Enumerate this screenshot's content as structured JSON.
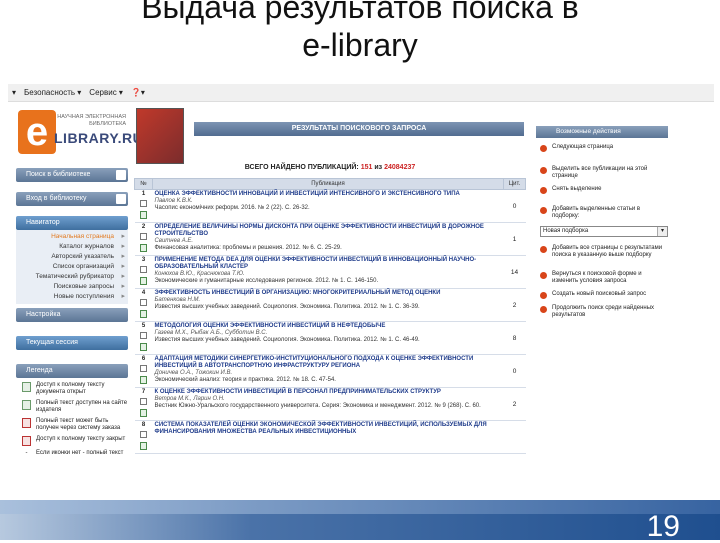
{
  "slide": {
    "title_line1": "Выдача результатов поиска в",
    "title_line2": "e-library",
    "page_number": "19"
  },
  "ie_toolbar": {
    "security": "Безопасность",
    "service": "Сервис"
  },
  "logo": {
    "tagline": "НАУЧНАЯ ЭЛЕКТРОННАЯ БИБЛИОТЕКА",
    "name": "LIBRARY.RU"
  },
  "left": {
    "search_btn": "Поиск в библиотеке",
    "login_btn": "Вход в библиотеку",
    "navigator": "Навигатор",
    "nav_items": [
      "Начальная страница",
      "Каталог журналов",
      "Авторский указатель",
      "Список организаций",
      "Тематический рубрикатор",
      "Поисковые запросы",
      "Новые поступления"
    ],
    "settings": "Настройка",
    "session": "Текущая сессия",
    "legend": "Легенда",
    "legend_items": [
      "Доступ к полному тексту документа открыт",
      "Полный текст доступен на сайте издателя",
      "Полный текст может быть получен через систему заказа",
      "Доступ к полному тексту закрыт",
      "Если иконки нет - полный текст"
    ]
  },
  "center": {
    "header": "РЕЗУЛЬТАТЫ ПОИСКОВОГО ЗАПРОСА",
    "total_prefix": "ВСЕГО НАЙДЕНО ПУБЛИКАЦИЙ:",
    "total_found": "151",
    "total_mid": "из",
    "total_all": "24084237",
    "col_num": "№",
    "col_pub": "Публикация",
    "col_cit": "Цит.",
    "rows": [
      {
        "n": "1",
        "title": "ОЦЕНКА ЭФФЕКТИВНОСТИ ИННОВАЦИЙ И ИНВЕСТИЦИЙ ИНТЕНСИВНОГО И ЭКСТЕНСИВНОГО ТИПА",
        "authors": "Павлов К.В.К.",
        "journal": "Часопис економічних реформ. 2016. № 2 (22). С. 26-32.",
        "cit": "0"
      },
      {
        "n": "2",
        "title": "ОПРЕДЕЛЕНИЕ ВЕЛИЧИНЫ НОРМЫ ДИСКОНТА ПРИ ОЦЕНКЕ ЭФФЕКТИВНОСТИ ИНВЕСТИЦИЙ В ДОРОЖНОЕ СТРОИТЕЛЬСТВО",
        "authors": "Свитнев А.Е.",
        "journal": "Финансовая аналитика: проблемы и решения. 2012. № 6. С. 25-29.",
        "cit": "1"
      },
      {
        "n": "3",
        "title": "ПРИМЕНЕНИЕ МЕТОДА DEA ДЛЯ ОЦЕНКИ ЭФФЕКТИВНОСТИ ИНВЕСТИЦИЙ В ИННОВАЦИОННЫЙ НАУЧНО-ОБРАЗОВАТЕЛЬНЫЙ КЛАСТЕР",
        "authors": "Конюхов В.Ю., Краснюкова Т.Ю.",
        "journal": "Экономические и гуманитарные исследования регионов. 2012. № 1. С. 146-150.",
        "cit": "14"
      },
      {
        "n": "4",
        "title": "ЭФФЕКТИВНОСТЬ ИНВЕСТИЦИЙ В ОРГАНИЗАЦИЮ: МНОГОКРИТЕРИАЛЬНЫЙ МЕТОД ОЦЕНКИ",
        "authors": "Батенкова Н.М.",
        "journal": "Известия высших учебных заведений. Социология. Экономика. Политика. 2012. № 1. С. 36-39.",
        "cit": "2"
      },
      {
        "n": "5",
        "title": "МЕТОДОЛОГИЯ ОЦЕНКИ ЭФФЕКТИВНОСТИ ИНВЕСТИЦИЙ В НЕФТЕДОБЫЧЕ",
        "authors": "Газеев М.Х., Рыбак А.Б., Субботин В.С.",
        "journal": "Известия высших учебных заведений. Социология. Экономика. Политика. 2012. № 1. С. 46-49.",
        "cit": "8"
      },
      {
        "n": "6",
        "title": "АДАПТАЦИЯ МЕТОДИКИ СИНЕРГЕТИКО-ИНСТИТУЦИОНАЛЬНОГО ПОДХОДА К ОЦЕНКЕ ЭФФЕКТИВНОСТИ ИНВЕСТИЦИЙ В АВТОТРАНСПОРТНУЮ ИНФРАСТРУКТУРУ РЕГИОНА",
        "authors": "Доничев О.А., Тожокин И.В.",
        "journal": "Экономический анализ: теория и практика. 2012. № 18. С. 47-54.",
        "cit": "0"
      },
      {
        "n": "7",
        "title": "К ОЦЕНКЕ ЭФФЕКТИВНОСТИ ИНВЕСТИЦИЙ В ПЕРСОНАЛ ПРЕДПРИНИМАТЕЛЬСКИХ СТРУКТУР",
        "authors": "Ветров М.К., Ларин О.Н.",
        "journal": "Вестник Южно-Уральского государственного университета. Серия: Экономика и менеджмент. 2012. № 9 (268). С. 60.",
        "cit": "2"
      },
      {
        "n": "8",
        "title": "СИСТЕМА ПОКАЗАТЕЛЕЙ ОЦЕНКИ ЭКОНОМИЧЕСКОЙ ЭФФЕКТИВНОСТИ ИНВЕСТИЦИЙ, ИСПОЛЬЗУЕМЫХ ДЛЯ ФИНАНСИРОВАНИЯ МНОЖЕСТВА РЕАЛЬНЫХ ИНВЕСТИЦИОННЫХ",
        "authors": "",
        "journal": "",
        "cit": ""
      }
    ]
  },
  "right": {
    "header": "Возможные действия",
    "actions_a": [
      "Следующая страница",
      "Выделить все публикации на этой странице",
      "Снять выделение",
      "Добавить выделенные статьи в подборку:"
    ],
    "select_value": "Новая подборка",
    "actions_b": [
      "Добавить все страницы с результатами поиска в указанную выше подборку",
      "Вернуться к поисковой форме и изменить условия запроса",
      "Создать новый поисковый запрос",
      "Продолжить поиск среди найденных результатов"
    ]
  }
}
